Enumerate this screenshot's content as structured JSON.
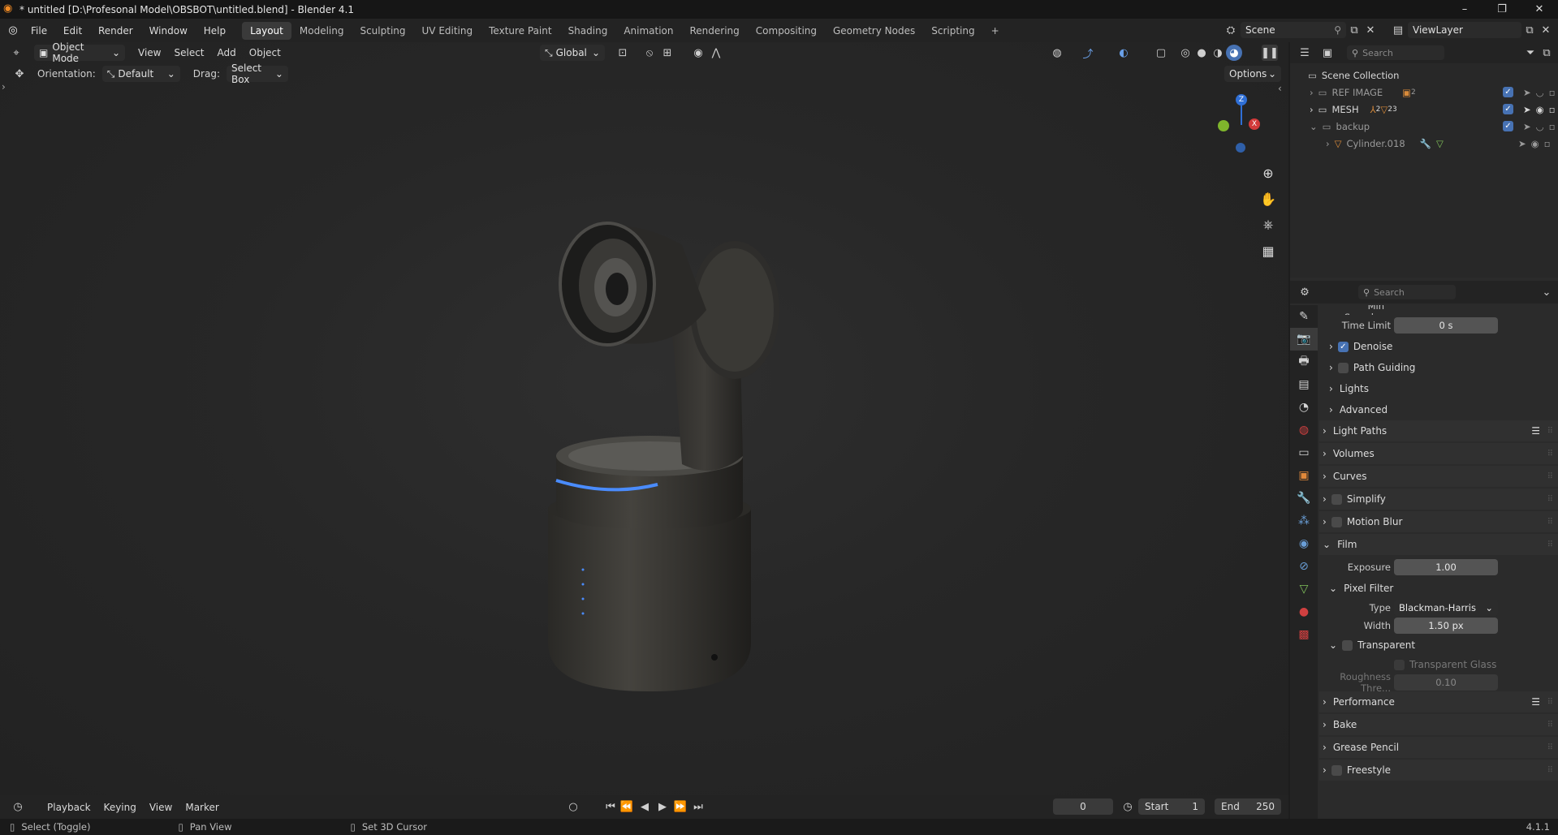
{
  "window": {
    "title": "* untitled [D:\\Profesonal Model\\OBSBOT\\untitled.blend] - Blender 4.1",
    "minimize": "–",
    "maximize": "❐",
    "close": "✕"
  },
  "menu": {
    "items": [
      "File",
      "Edit",
      "Render",
      "Window",
      "Help"
    ],
    "workspaces": [
      "Layout",
      "Modeling",
      "Sculpting",
      "UV Editing",
      "Texture Paint",
      "Shading",
      "Animation",
      "Rendering",
      "Compositing",
      "Geometry Nodes",
      "Scripting"
    ],
    "active_workspace": "Layout",
    "add_workspace": "+",
    "scene": "Scene",
    "view_layer": "ViewLayer"
  },
  "viewport": {
    "mode": "Object Mode",
    "menus": [
      "View",
      "Select",
      "Add",
      "Object"
    ],
    "transform": "Global",
    "orientation_label": "Orientation:",
    "orientation_value": "Default",
    "drag_label": "Drag:",
    "drag_value": "Select Box",
    "options": "Options",
    "gizmo": {
      "x": "X",
      "y": "Y",
      "z": "Z"
    }
  },
  "outliner": {
    "search_placeholder": "Search",
    "root": "Scene Collection",
    "rows": [
      {
        "name": "REF IMAGE",
        "badge": "2",
        "expanded": false
      },
      {
        "name": "MESH",
        "badge": "2",
        "badge2": "23",
        "expanded": false
      },
      {
        "name": "backup",
        "expanded": true
      },
      {
        "name": "Cylinder.018"
      }
    ]
  },
  "properties": {
    "search_placeholder": "Search",
    "cut_label": "Min Samples",
    "time_limit_label": "Time Limit",
    "time_limit_value": "0 s",
    "denoise": "Denoise",
    "path_guiding": "Path Guiding",
    "lights": "Lights",
    "advanced": "Advanced",
    "light_paths": "Light Paths",
    "volumes": "Volumes",
    "curves": "Curves",
    "simplify": "Simplify",
    "motion_blur": "Motion Blur",
    "film": "Film",
    "exposure_label": "Exposure",
    "exposure_value": "1.00",
    "pixel_filter": "Pixel Filter",
    "type_label": "Type",
    "type_value": "Blackman-Harris",
    "width_label": "Width",
    "width_value": "1.50 px",
    "transparent": "Transparent",
    "transparent_glass": "Transparent Glass",
    "roughness_label": "Roughness Thre...",
    "roughness_value": "0.10",
    "performance": "Performance",
    "bake": "Bake",
    "grease_pencil": "Grease Pencil",
    "freestyle": "Freestyle"
  },
  "timeline": {
    "menus": [
      "Playback",
      "Keying",
      "View",
      "Marker"
    ],
    "current_frame": "0",
    "start_label": "Start",
    "start_value": "1",
    "end_label": "End",
    "end_value": "250"
  },
  "status": {
    "select": "Select (Toggle)",
    "pan": "Pan View",
    "cursor": "Set 3D Cursor",
    "version": "4.1.1"
  },
  "colors": {
    "accent": "#4772b3",
    "active_tab": "#3a3a3a",
    "led": "#4a8cff"
  }
}
